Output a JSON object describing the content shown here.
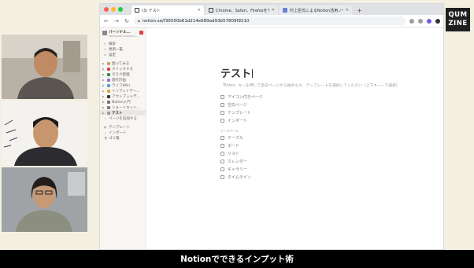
{
  "browser": {
    "tabs": [
      {
        "label": "(3) テスト",
        "active": true
      },
      {
        "label": "Chrome、Safari、Firefoxをモバ",
        "active": false
      },
      {
        "label": "村上臣氏によるNotion活用ノウハ",
        "active": false
      }
    ],
    "url": "notion.so/f36550b61d214e689ad93b57809f9210",
    "window_dot_colors": [
      "#ff5f57",
      "#febc2e",
      "#28c840"
    ]
  },
  "sidebar": {
    "workspace_name": "パーソナル...",
    "workspace_email": "kazuyoshi.tsutsumi...",
    "top_items": [
      "検索",
      "更新一覧",
      "設定"
    ],
    "pages": [
      {
        "label": "困ってみる",
        "color": "#c4a35a"
      },
      {
        "label": "クイックメモ",
        "color": "#e03e3e"
      },
      {
        "label": "タスク管理",
        "color": "#2f8f46"
      },
      {
        "label": "旅行計画",
        "color": "#9a6dd7"
      },
      {
        "label": "ライフWiki",
        "color": "#5b9bd5"
      },
      {
        "label": "インプットデー...",
        "color": "#e0a03e"
      },
      {
        "label": "アウトプットデ...",
        "color": "#333333"
      },
      {
        "label": "Notion入門",
        "color": "#777777"
      },
      {
        "label": "ショートカット...",
        "color": "#777777"
      },
      {
        "label": "テスト",
        "color": "#9b9a97",
        "selected": true
      }
    ],
    "add_page": "ページを追加する",
    "bottom_items": [
      "テンプレート",
      "インポート",
      "ゴミ箱"
    ]
  },
  "page": {
    "title": "テスト",
    "hint": "「Enter」キーを押して空白ページから始めるか、テンプレートを選択してください（上下キーーで選択）",
    "options": [
      "アイコン付きページ",
      "空白ページ",
      "テンプレート",
      "インポート"
    ],
    "database_heading": "データベース",
    "database_options": [
      "テーブル",
      "ボード",
      "リスト",
      "カレンダー",
      "ギャラリー",
      "タイムライン"
    ]
  },
  "logo": {
    "line1": "QUM",
    "line2": "ZINE"
  },
  "caption": "Notionでできるインプット術"
}
